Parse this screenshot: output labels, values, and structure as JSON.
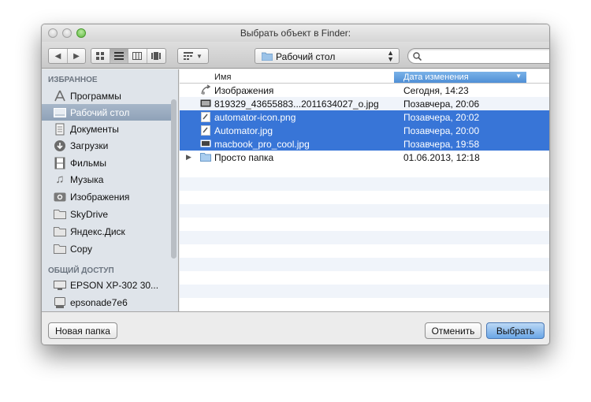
{
  "window": {
    "title": "Выбрать объект в Finder:"
  },
  "toolbar": {
    "back_icon": "back-arrow",
    "forward_icon": "forward-arrow",
    "location": "Рабочий стол",
    "search_placeholder": ""
  },
  "sidebar": {
    "favorites_header": "ИЗБРАННОЕ",
    "favorites": [
      {
        "label": "Программы",
        "icon": "applications-icon",
        "selected": false
      },
      {
        "label": "Рабочий стол",
        "icon": "desktop-icon",
        "selected": true
      },
      {
        "label": "Документы",
        "icon": "documents-icon",
        "selected": false
      },
      {
        "label": "Загрузки",
        "icon": "downloads-icon",
        "selected": false
      },
      {
        "label": "Фильмы",
        "icon": "movies-icon",
        "selected": false
      },
      {
        "label": "Музыка",
        "icon": "music-icon",
        "selected": false
      },
      {
        "label": "Изображения",
        "icon": "pictures-icon",
        "selected": false
      },
      {
        "label": "SkyDrive",
        "icon": "folder-icon",
        "selected": false
      },
      {
        "label": "Яндекс.Диск",
        "icon": "folder-icon",
        "selected": false
      },
      {
        "label": "Copy",
        "icon": "folder-icon",
        "selected": false
      }
    ],
    "shared_header": "ОБЩИЙ ДОСТУП",
    "shared": [
      {
        "label": "EPSON XP-302 30...",
        "icon": "display-icon"
      },
      {
        "label": "epsonade7e6",
        "icon": "computer-icon"
      }
    ]
  },
  "list": {
    "col_name": "Имя",
    "col_date": "Дата изменения",
    "rows": [
      {
        "name": "Изображения",
        "date": "Сегодня, 14:23",
        "icon": "alias-icon",
        "selected": false,
        "expandable": false
      },
      {
        "name": "819329_43655883...2011634027_o.jpg",
        "date": "Позавчера, 20:06",
        "icon": "image-file-icon",
        "selected": false,
        "expandable": false
      },
      {
        "name": "automator-icon.png",
        "date": "Позавчера, 20:02",
        "icon": "image-file-icon",
        "selected": true,
        "expandable": false
      },
      {
        "name": "Automator.jpg",
        "date": "Позавчера, 20:00",
        "icon": "image-file-icon",
        "selected": true,
        "expandable": false
      },
      {
        "name": "macbook_pro_cool.jpg",
        "date": "Позавчера, 19:58",
        "icon": "image-file-icon",
        "selected": true,
        "expandable": false
      },
      {
        "name": "Просто папка",
        "date": "01.06.2013, 12:18",
        "icon": "folder-icon",
        "selected": false,
        "expandable": true
      }
    ]
  },
  "buttons": {
    "new_folder": "Новая папка",
    "cancel": "Отменить",
    "choose": "Выбрать"
  },
  "colors": {
    "selection": "#3875d7",
    "sidebar_bg": "#dfe4ea",
    "sidebar_selection": "#8fa2b8",
    "primary_button": "#6aa6e6"
  }
}
